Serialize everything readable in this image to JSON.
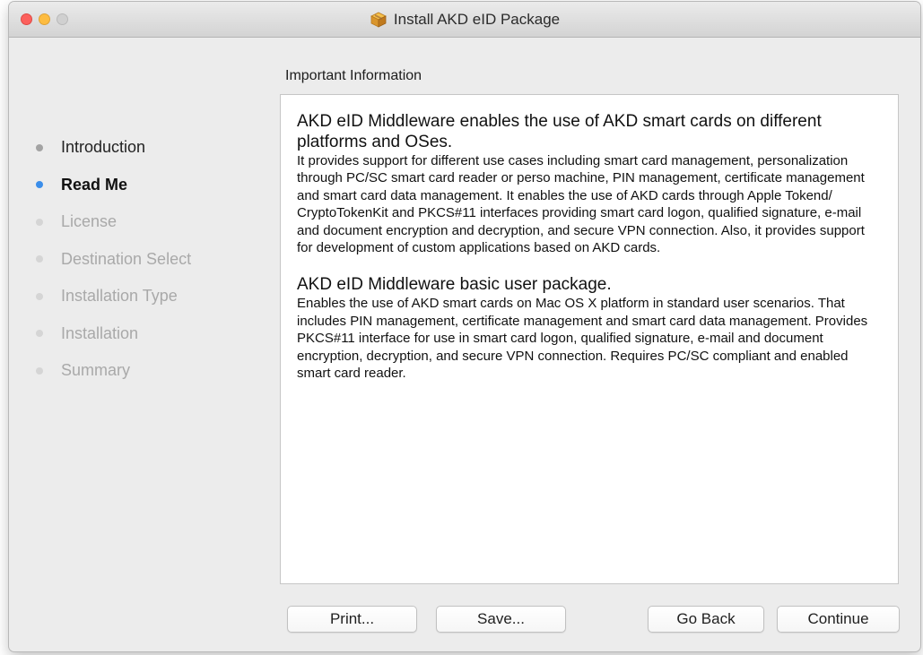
{
  "window": {
    "title": "Install AKD eID Package",
    "title_icon": "package-box-icon"
  },
  "colors": {
    "current_step_bullet": "#3b8eea",
    "close_button": "#fc605c",
    "minimize_button": "#fdbc40"
  },
  "sidebar": {
    "steps": [
      {
        "label": "Introduction",
        "state": "done"
      },
      {
        "label": "Read Me",
        "state": "current"
      },
      {
        "label": "License",
        "state": "pending"
      },
      {
        "label": "Destination Select",
        "state": "pending"
      },
      {
        "label": "Installation Type",
        "state": "pending"
      },
      {
        "label": "Installation",
        "state": "pending"
      },
      {
        "label": "Summary",
        "state": "pending"
      }
    ]
  },
  "main": {
    "heading": "Important Information",
    "sections": [
      {
        "title": "AKD eID Middleware enables the use of AKD smart cards on different platforms and OSes.",
        "body": "It provides support for different use cases including smart card management, personalization through PC/SC smart card reader or perso machine, PIN management, certificate management and smart card data management. It enables the use of AKD cards through Apple Tokend/ CryptoTokenKit and PKCS#11 interfaces providing smart card logon, qualified signature, e-mail and document encryption and decryption, and secure VPN connection. Also, it provides support for development of custom applications based on AKD cards."
      },
      {
        "title": "AKD eID Middleware basic user package.",
        "body": "Enables the use of AKD smart cards on Mac OS X platform in standard user scenarios. That includes PIN management, certificate management and smart card data management. Provides PKCS#11 interface for use in smart card logon, qualified signature, e-mail and document encryption, decryption, and secure VPN connection. Requires PC/SC compliant and enabled smart card reader."
      }
    ]
  },
  "buttons": {
    "print": "Print...",
    "save": "Save...",
    "go_back": "Go Back",
    "continue": "Continue"
  }
}
